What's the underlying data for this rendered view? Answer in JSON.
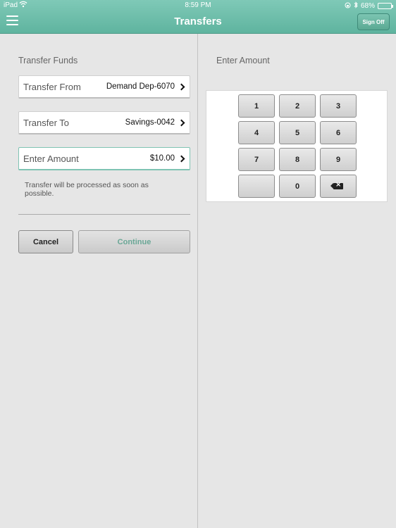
{
  "status_bar": {
    "carrier": "iPad",
    "time": "8:59 PM",
    "battery": "68%",
    "battery_level": 0.68
  },
  "header": {
    "title": "Transfers",
    "sign_off_label": "Sign Off"
  },
  "left_pane": {
    "section_title": "Transfer Funds",
    "transfer_from": {
      "label": "Transfer From",
      "value": "Demand Dep-6070"
    },
    "transfer_to": {
      "label": "Transfer To",
      "value": "Savings-0042"
    },
    "amount": {
      "label": "Enter Amount",
      "value": "$10.00"
    },
    "note": "Transfer will be processed as soon as possible.",
    "cancel_label": "Cancel",
    "continue_label": "Continue"
  },
  "right_pane": {
    "section_title": "Enter Amount",
    "keys": [
      "1",
      "2",
      "3",
      "4",
      "5",
      "6",
      "7",
      "8",
      "9",
      "",
      "0",
      "backspace-icon"
    ]
  },
  "colors": {
    "header_teal": "#6fbfab",
    "continue_text": "#6aa796",
    "active_field_border": "#7fc4b3"
  }
}
